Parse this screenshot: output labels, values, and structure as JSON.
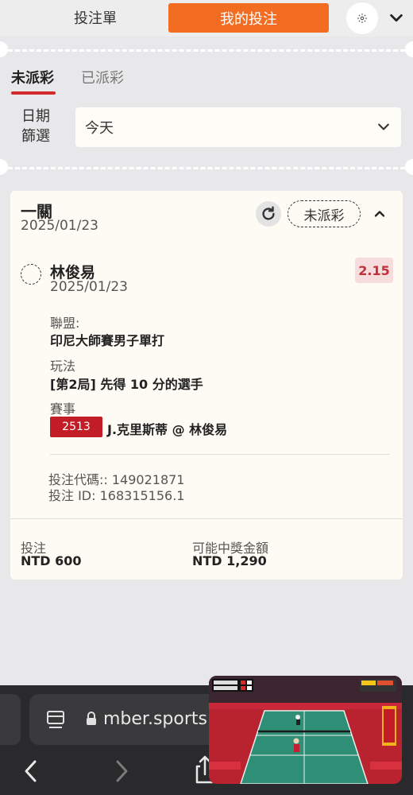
{
  "header": {
    "betslip_label": "投注單",
    "mybets_label": "我的投注"
  },
  "filter": {
    "tab_unsettled": "未派彩",
    "tab_settled": "已派彩",
    "date_label_line1": "日期",
    "date_label_line2": "篩選",
    "date_value": "今天"
  },
  "bet": {
    "type": "一關",
    "date": "2025/01/23",
    "status": "未派彩",
    "selection": {
      "name": "林俊易",
      "date": "2025/01/23",
      "odds": "2.15",
      "league_label": "聯盟:",
      "league_value": "印尼大師賽男子單打",
      "market_label": "玩法",
      "market_value": "[第2局] 先得 10 分的選手",
      "event_label": "賽事",
      "event_id": "2513",
      "event_name": "J.克里斯蒂 @ 林俊易"
    },
    "bet_code": "投注代碼:: 149021871",
    "bet_id": "投注 ID: 168315156.1",
    "stake_label": "投注",
    "stake_value": "NTD 600",
    "potential_win_label": "可能中獎金額",
    "potential_win_value": "NTD 1,290"
  },
  "browser": {
    "url": "mber.sports"
  },
  "colors": {
    "accent_orange": "#f26d21",
    "accent_red": "#c21d26",
    "odds_bg": "#f6dcdc",
    "card_bg": "#fdfbf3",
    "page_bg": "#e8e8ea"
  },
  "icons": {
    "settings": "gear-icon",
    "dropdown": "chevron-down-icon",
    "refresh": "refresh-icon",
    "collapse": "chevron-up-icon",
    "pending": "pending-circle-icon",
    "tabs": "tabs-icon",
    "lock": "lock-icon",
    "back": "back-icon",
    "forward": "forward-icon",
    "share": "share-icon"
  }
}
